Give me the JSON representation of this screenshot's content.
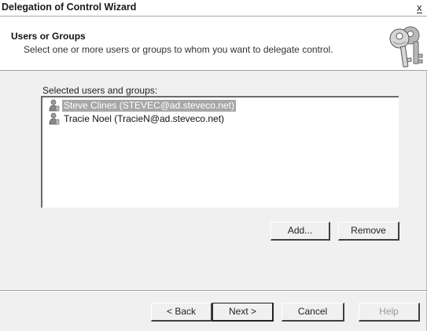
{
  "window": {
    "title": "Delegation of Control Wizard",
    "close_glyph": "x"
  },
  "header": {
    "title": "Users or Groups",
    "subtitle": "Select one or more users or groups to whom you want to delegate control.",
    "icon": "keys-icon"
  },
  "list": {
    "label": "Selected users and groups:",
    "items": [
      {
        "text": "Steve Clines (STEVEC@ad.steveco.net)",
        "selected": true,
        "icon": "user-icon"
      },
      {
        "text": "Tracie Noel (TracieN@ad.steveco.net)",
        "selected": false,
        "icon": "user-icon"
      }
    ]
  },
  "buttons": {
    "add": "Add...",
    "remove": "Remove",
    "back": "< Back",
    "next": "Next >",
    "cancel": "Cancel",
    "help": "Help"
  },
  "colors": {
    "selection_bg": "#a7a7a7",
    "dialog_bg": "#f0f0f0",
    "header_bg": "#ffffff"
  }
}
